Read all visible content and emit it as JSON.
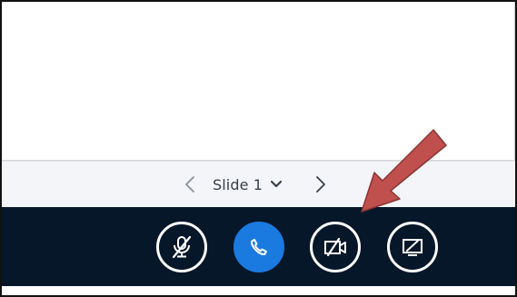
{
  "slide_nav": {
    "slide_label": "Slide 1",
    "prev_icon": "chevron-left-icon",
    "next_icon": "chevron-right-icon",
    "dropdown_icon": "chevron-down-icon"
  },
  "controls": {
    "mic": {
      "icon": "microphone-muted-icon"
    },
    "phone": {
      "icon": "phone-icon"
    },
    "camera": {
      "icon": "video-camera-off-icon"
    },
    "screen": {
      "icon": "screen-share-off-icon"
    }
  },
  "colors": {
    "control_bar": "#06172a",
    "accent_blue": "#1b7ae0",
    "nav_background": "#f3f5f8",
    "annotation_arrow": "#c0504d"
  }
}
